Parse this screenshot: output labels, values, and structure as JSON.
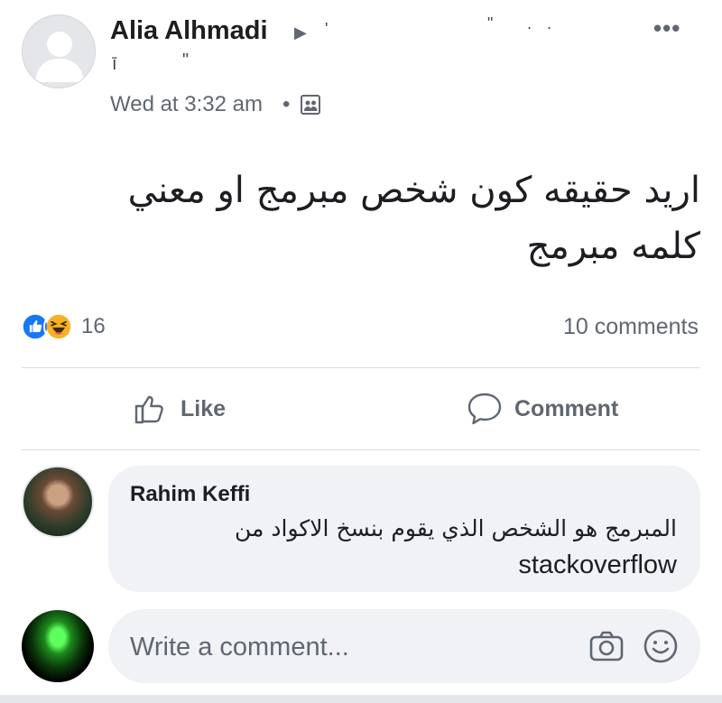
{
  "post": {
    "author": "Alia Alhmadi",
    "sub_mark": "ī",
    "sub_dots": "\"",
    "header_dots_1": "'",
    "header_dots_2": "\"",
    "header_dots_3": ". .",
    "more_label": "•••",
    "time": "Wed at 3:32 am",
    "time_separator": "•",
    "audience_icon": "group-icon",
    "text_line1": "اريد حقيقه كون شخص مبرمج او معني",
    "text_line2": "كلمه مبرمج"
  },
  "reactions": {
    "icons": [
      "like-reaction-icon",
      "haha-reaction-icon"
    ],
    "count": "16",
    "comments_count": "10 comments"
  },
  "actions": {
    "like": "Like",
    "comment": "Comment"
  },
  "comment": {
    "author": "Rahim Keffi",
    "text_ar": "المبرمج هو الشخص الذي يقوم بنسخ الاكواد من",
    "text_en": "stackoverflow"
  },
  "composer": {
    "placeholder": "Write a comment...",
    "camera_icon": "camera-icon",
    "emoji_icon": "emoji-icon"
  },
  "colors": {
    "text_primary": "#1c1e21",
    "text_secondary": "#606770",
    "like_blue": "#1877f2",
    "haha_yellow": "#f7b125",
    "bubble_bg": "#f0f2f5"
  }
}
